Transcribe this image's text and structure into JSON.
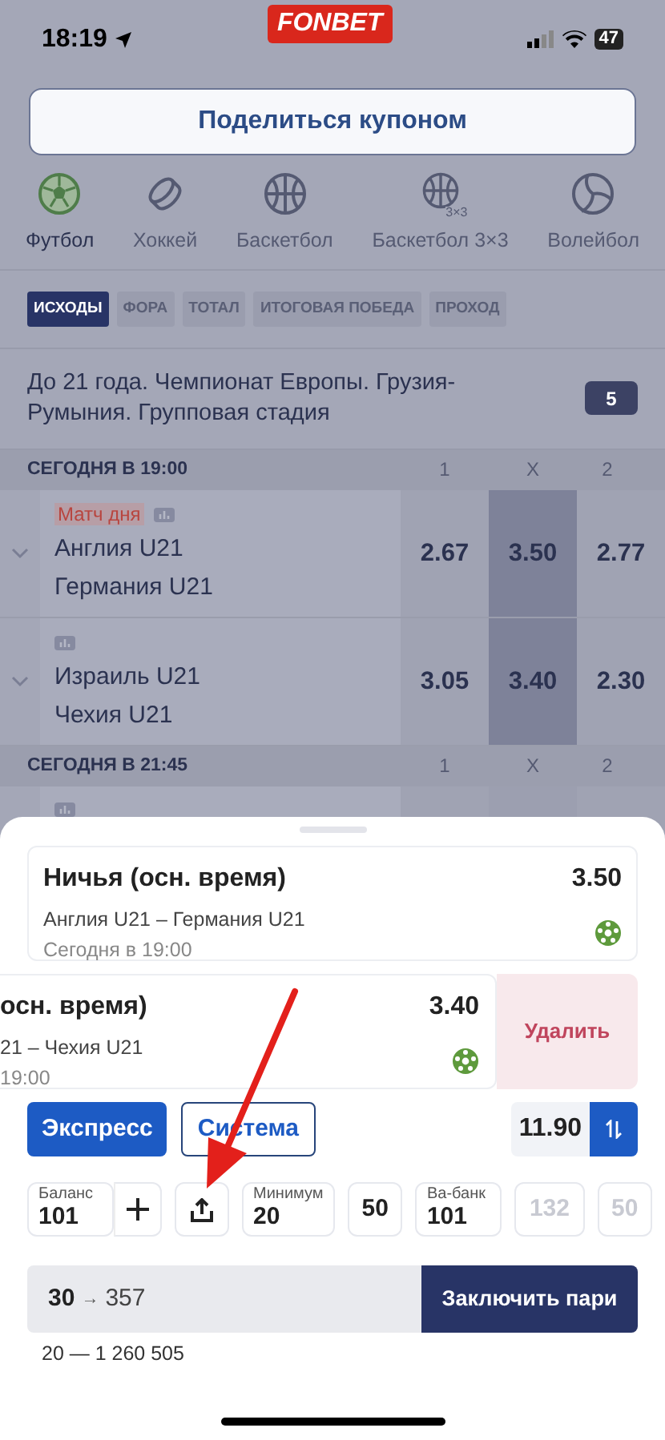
{
  "status_bar": {
    "time": "18:19",
    "logo": "FONBET",
    "battery": "47"
  },
  "share_button": "Поделиться купоном",
  "sports": [
    {
      "kind": "football",
      "label": "Футбол",
      "selected": true
    },
    {
      "kind": "hockey",
      "label": "Хоккей",
      "selected": false
    },
    {
      "kind": "basketball",
      "label": "Баскетбол",
      "selected": false
    },
    {
      "kind": "basketball3x3",
      "label": "Баскетбол 3×3",
      "icon_caption": "3×3",
      "selected": false
    },
    {
      "kind": "volleyball",
      "label": "Волейбол",
      "selected": false
    }
  ],
  "market_tabs": [
    {
      "label": "ИСХОДЫ",
      "selected": true
    },
    {
      "label": "ФОРА",
      "selected": false
    },
    {
      "label": "ТОТАЛ",
      "selected": false
    },
    {
      "label": "ИТОГОВАЯ ПОБЕДА",
      "selected": false
    },
    {
      "label": "ПРОХОД",
      "selected": false
    }
  ],
  "league": {
    "title": "До 21 года. Чемпионат Европы. Грузия-Румыния. Групповая стадия",
    "count": "5"
  },
  "sections": [
    {
      "time": "СЕГОДНЯ В 19:00",
      "columns": [
        "1",
        "X",
        "2"
      ],
      "matches": [
        {
          "kind": "full",
          "badge": "Матч дня",
          "team1": "Англия U21",
          "team2": "Германия U21",
          "odds": [
            {
              "value": "2.67",
              "selected": false
            },
            {
              "value": "3.50",
              "selected": true
            },
            {
              "value": "2.77",
              "selected": false
            }
          ]
        },
        {
          "kind": "full",
          "team1": "Израиль U21",
          "team2": "Чехия U21",
          "odds": [
            {
              "value": "3.05",
              "selected": false
            },
            {
              "value": "3.40",
              "selected": true
            },
            {
              "value": "2.30",
              "selected": false
            }
          ]
        }
      ]
    },
    {
      "time": "СЕГОДНЯ В 21:45",
      "columns": [
        "1",
        "X",
        "2"
      ],
      "matches": [
        {
          "kind": "partial"
        }
      ]
    }
  ],
  "coupon": {
    "cards": [
      {
        "selection": "Ничья (осн. время)",
        "odds": "3.50",
        "match": "Англия U21 – Германия U21",
        "time": "Сегодня в 19:00",
        "swiped": false
      },
      {
        "selection": "осн. время)",
        "odds": "3.40",
        "match": "21 – Чехия U21",
        "time": "19:00",
        "swiped": true
      }
    ],
    "delete_action": "Удалить",
    "bet_types": [
      {
        "label": "Экспресс",
        "selected": true
      },
      {
        "label": "Система",
        "selected": false
      }
    ],
    "total_odds": "11.90",
    "chips": [
      {
        "kind": "field",
        "label": "Баланс",
        "value": "101"
      },
      {
        "kind": "plus"
      },
      {
        "kind": "share"
      },
      {
        "kind": "field",
        "label": "Минимум",
        "value": "20"
      },
      {
        "kind": "amount",
        "value": "50",
        "disabled": false
      },
      {
        "kind": "field",
        "label": "Ва-банк",
        "value": "101"
      },
      {
        "kind": "amount",
        "value": "132",
        "disabled": true
      },
      {
        "kind": "amount",
        "value": "50",
        "disabled": true
      }
    ],
    "stake": "30",
    "arrow": "→",
    "payout": "357",
    "place_bet": "Заключить пари",
    "range": "20 — 1 260 505"
  }
}
